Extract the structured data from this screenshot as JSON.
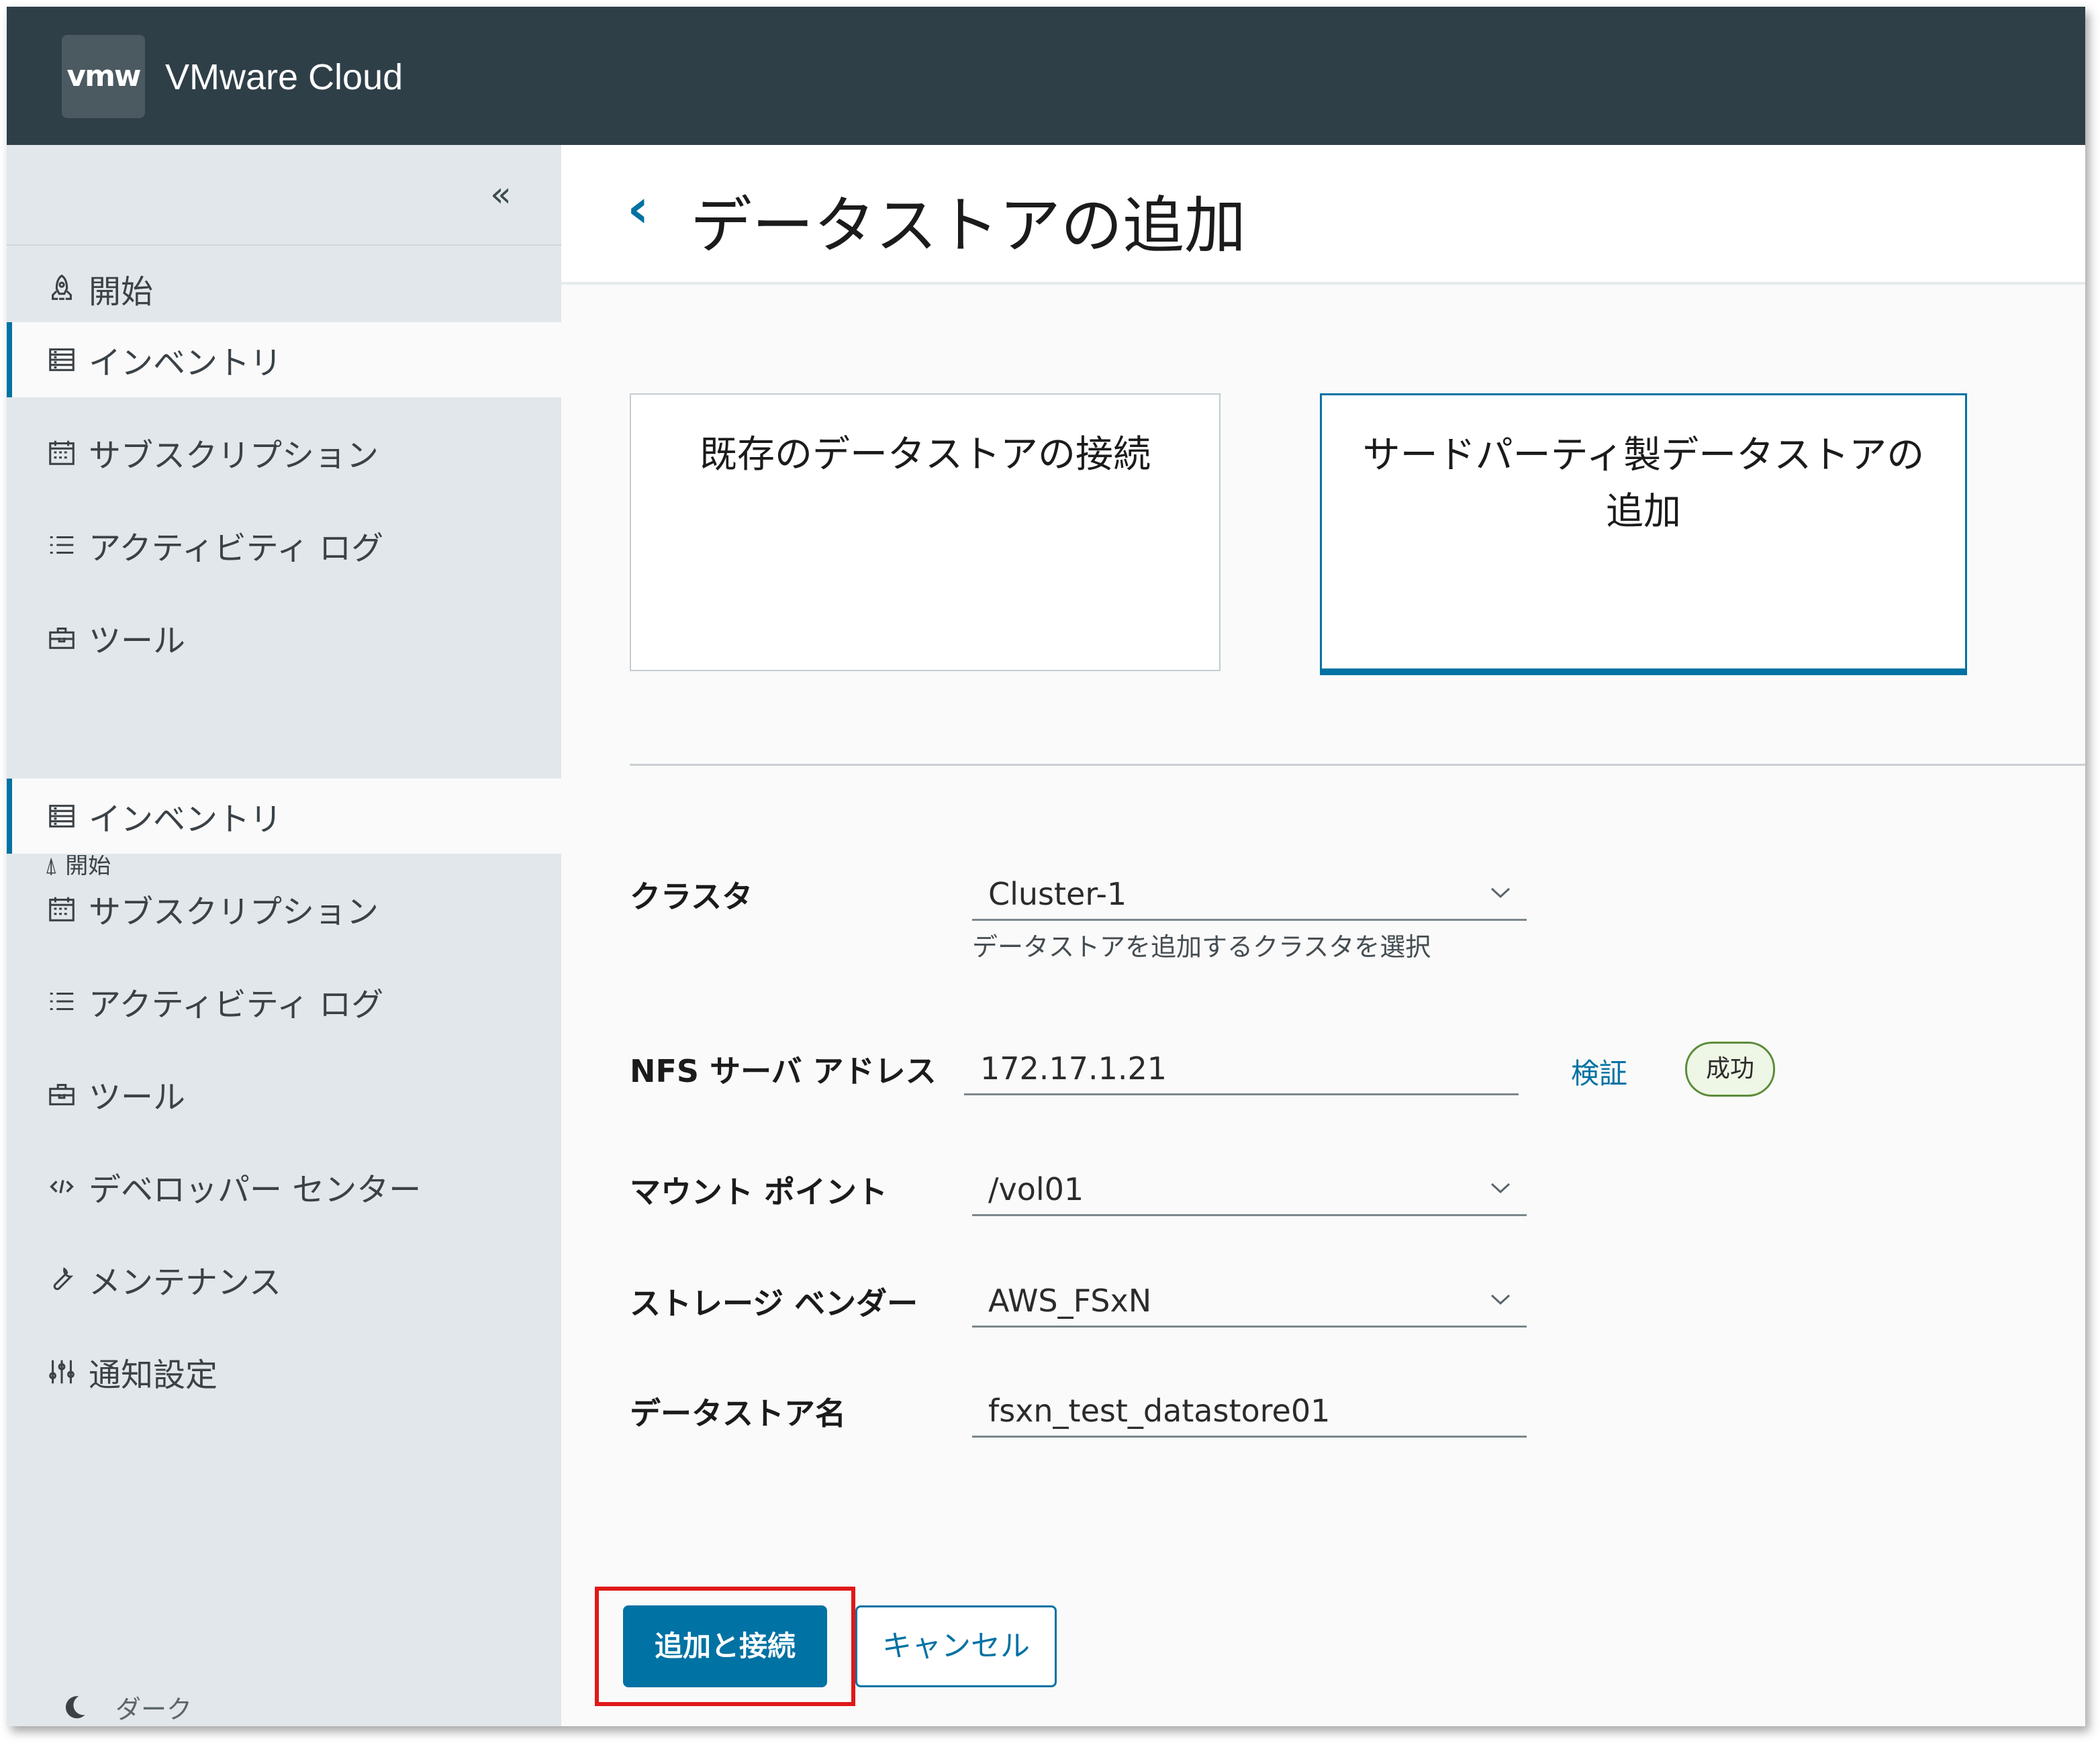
{
  "header": {
    "logo_text": "vmw",
    "app_title": "VMware Cloud"
  },
  "sidebar": {
    "collapse_icon": "double-chevron-left-icon",
    "items": [
      {
        "label": "開始",
        "icon": "rocket-icon"
      },
      {
        "label": "インベントリ",
        "icon": "inventory-icon",
        "active": true
      },
      {
        "label": "サブスクリプション",
        "icon": "calendar-icon"
      },
      {
        "label": "アクティビティ ログ",
        "icon": "list-icon"
      },
      {
        "label": "ツール",
        "icon": "toolbox-icon"
      }
    ],
    "cut_item": {
      "label": "開始",
      "icon": "rocket-icon"
    },
    "items2": [
      {
        "label": "インベントリ",
        "icon": "inventory-icon",
        "active": true
      },
      {
        "label": "サブスクリプション",
        "icon": "calendar-icon"
      },
      {
        "label": "アクティビティ ログ",
        "icon": "list-icon"
      },
      {
        "label": "ツール",
        "icon": "toolbox-icon"
      },
      {
        "label": "デベロッパー センター",
        "icon": "code-icon"
      },
      {
        "label": "メンテナンス",
        "icon": "wrench-icon"
      },
      {
        "label": "通知設定",
        "icon": "sliders-icon"
      }
    ],
    "dark_label": "ダーク"
  },
  "main": {
    "back_glyph": "‹",
    "title": "データストアの追加",
    "cards": [
      {
        "label": "既存のデータストアの接続"
      },
      {
        "label": "サードパーティ製データストアの追加",
        "selected": true
      }
    ],
    "form": {
      "cluster_label": "クラスタ",
      "cluster_value": "Cluster-1",
      "cluster_helper": "データストアを追加するクラスタを選択",
      "nfs_label": "NFS サーバ アドレス",
      "nfs_value": "172.17.1.21",
      "verify_label": "検証",
      "status_badge": "成功",
      "mount_label": "マウント ポイント",
      "mount_value": "/vol01",
      "vendor_label": "ストレージ ベンダー",
      "vendor_value": "AWS_FSxN",
      "datastore_label": "データストア名",
      "datastore_value": "fsxn_test_datastore01"
    },
    "buttons": {
      "primary": "追加と接続",
      "cancel": "キャンセル"
    }
  },
  "colors": {
    "header_bg": "#2f3f48",
    "accent": "#0072a3",
    "sidebar_bg": "#e1e7ea",
    "success_border": "#5d8b3a",
    "highlight": "#e01818"
  }
}
